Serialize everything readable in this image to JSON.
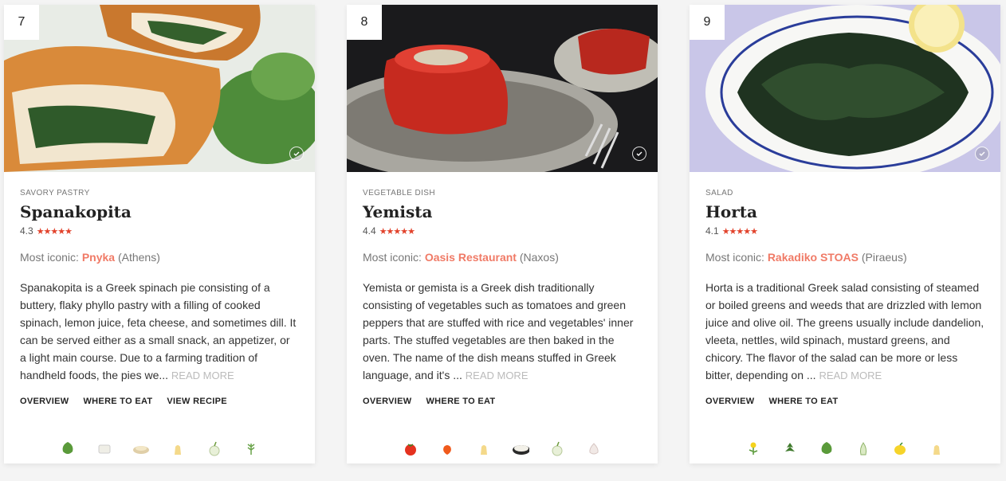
{
  "cards": [
    {
      "rank": "7",
      "category": "SAVORY PASTRY",
      "title": "Spanakopita",
      "rating": "4.3",
      "stars": "★★★★★",
      "iconic_label": "Most iconic:",
      "place": "Pnyka",
      "city": "(Athens)",
      "description": "Spanakopita is a Greek spinach pie consisting of a buttery, flaky phyllo pastry with a filling of cooked spinach, lemon juice, feta cheese, and sometimes dill. It can be served either as a small snack, an appetizer, or a light main course. Due to a farming tradition of handheld foods, the pies we...",
      "read_more": "READ MORE",
      "links": [
        "OVERVIEW",
        "WHERE TO EAT",
        "VIEW RECIPE"
      ],
      "ingredients": [
        "spinach-icon",
        "feta-icon",
        "flour-icon",
        "butter-icon",
        "onion-icon",
        "dill-icon"
      ]
    },
    {
      "rank": "8",
      "category": "VEGETABLE DISH",
      "title": "Yemista",
      "rating": "4.4",
      "stars": "★★★★★",
      "iconic_label": "Most iconic:",
      "place": "Oasis Restaurant",
      "city": "(Naxos)",
      "description": "Yemista or gemista is a Greek dish traditionally consisting of vegetables such as tomatoes and green peppers that are stuffed with rice and vegetables' inner parts. The stuffed vegetables are then baked in the oven. The name of the dish means stuffed in Greek language, and it's ...",
      "read_more": "READ MORE",
      "links": [
        "OVERVIEW",
        "WHERE TO EAT"
      ],
      "ingredients": [
        "tomato-icon",
        "pepper-icon",
        "olive-oil-icon",
        "rice-icon",
        "onion-icon",
        "garlic-icon"
      ]
    },
    {
      "rank": "9",
      "category": "SALAD",
      "title": "Horta",
      "rating": "4.1",
      "stars": "★★★★★",
      "iconic_label": "Most iconic:",
      "place": "Rakadiko STOAS",
      "city": "(Piraeus)",
      "description": "Horta is a traditional Greek salad consisting of steamed or boiled greens and weeds that are drizzled with lemon juice and olive oil. The greens usually include dandelion, vleeta, nettles, wild spinach, mustard greens, and chicory. The flavor of the salad can be more or less bitter, depending on ...",
      "read_more": "READ MORE",
      "links": [
        "OVERVIEW",
        "WHERE TO EAT"
      ],
      "ingredients": [
        "dandelion-icon",
        "nettle-icon",
        "spinach-icon",
        "chicory-icon",
        "lemon-icon",
        "olive-oil-icon"
      ]
    }
  ],
  "colors": {
    "accent": "#f07a66",
    "stars": "#e2432c",
    "muted": "#777777"
  }
}
